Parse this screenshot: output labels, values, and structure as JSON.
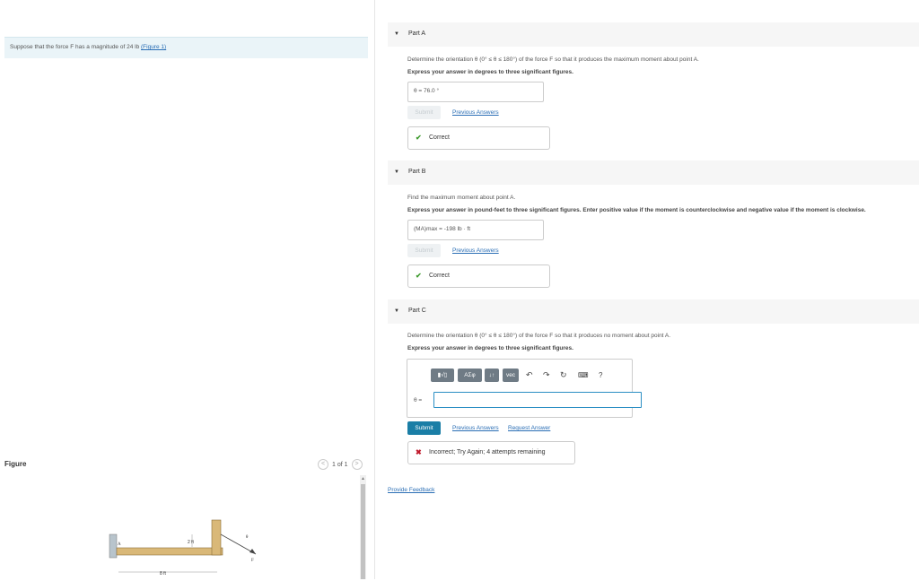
{
  "problem": {
    "text": "Suppose that the force F has a magnitude of 24 lb",
    "figure_link": "(Figure 1)"
  },
  "figure": {
    "label": "Figure",
    "pager_text": "1 of 1",
    "prev_icon": "chevron-left-icon",
    "next_icon": "chevron-right-icon",
    "dim_2ft": "2 ft",
    "dim_8ft": "8 ft",
    "label_A": "A",
    "label_F": "F",
    "label_theta": "θ"
  },
  "partA": {
    "title": "Part A",
    "question": "Determine the orientation θ (0° ≤ θ ≤ 180°) of the force F so that it produces the maximum moment about point A.",
    "instruction": "Express your answer in degrees to three significant figures.",
    "answer": "θ = 76.0 °",
    "submit": "Submit",
    "previous": "Previous Answers",
    "status": "Correct"
  },
  "partB": {
    "title": "Part B",
    "question": "Find the maximum moment about point A.",
    "instruction": "Express your answer in pound-feet to three significant figures. Enter positive value if the moment is counterclockwise and negative value if the moment is clockwise.",
    "answer": "(MA)max = -198 lb · ft",
    "submit": "Submit",
    "previous": "Previous Answers",
    "status": "Correct"
  },
  "partC": {
    "title": "Part C",
    "question": "Determine the orientation θ (0° ≤ θ ≤ 180°) of the force F so that it produces no moment about point A.",
    "instruction": "Express your answer in degrees to three significant figures.",
    "toolbar": {
      "templates": "▮√▯",
      "greek": "ΑΣφ",
      "arrows": "↓↑",
      "vec": "vec",
      "undo_icon": "undo-icon",
      "redo_icon": "redo-icon",
      "reset_icon": "reset-icon",
      "keyboard_icon": "keyboard-icon",
      "help": "?"
    },
    "input_label": "θ =",
    "input_value": "",
    "submit": "Submit",
    "previous": "Previous Answers",
    "request": "Request Answer",
    "status": "Incorrect; Try Again; 4 attempts remaining"
  },
  "feedback": "Provide Feedback",
  "colors": {
    "accent": "#1a7ea6",
    "correct": "#3c9a2c",
    "incorrect": "#c0192b",
    "link": "#2a6eb5"
  }
}
